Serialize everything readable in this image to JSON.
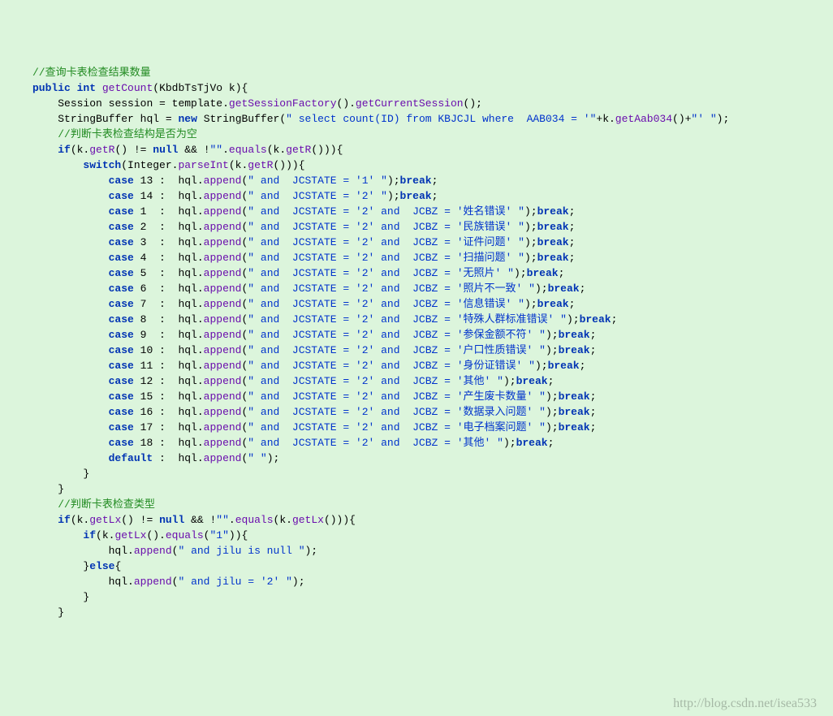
{
  "comments": {
    "c1": "//查询卡表检查结果数量",
    "c2": "//判断卡表检查结构是否为空",
    "c3": "//判断卡表检查类型"
  },
  "decl": {
    "public": "public",
    "int": "int",
    "getCount": "getCount",
    "param_type": "KbdbTsTjVo",
    "param_name": "k"
  },
  "line1": {
    "Session": "Session",
    "session": "session",
    "eq": " = ",
    "template": "template",
    "dot1": ".",
    "m1": "getSessionFactory",
    "p1": "().",
    "m2": "getCurrentSession",
    "p2": "();"
  },
  "line2": {
    "StringBuffer": "StringBuffer",
    "hql": "hql",
    "eq": " = ",
    "new": "new",
    "ctor": "StringBuffer",
    "open": "(",
    "str": "\" select count(ID) from KBJCJL where  AAB034 = '\"",
    "plus1": "+k.",
    "getAab": "getAab034",
    "plus2": "()+",
    "str2": "\"' \"",
    "close": ");"
  },
  "if1": {
    "if": "if",
    "open": "(k.",
    "getR1": "getR",
    "mid1": "() != ",
    "null": "null",
    "mid2": " && !",
    "emptystr": "\"\"",
    "dot": ".",
    "equals": "equals",
    "open2": "(k.",
    "getR2": "getR",
    "close2": "())){"
  },
  "switch": {
    "switch": "switch",
    "open": "(Integer.",
    "parseInt": "parseInt",
    "open2": "(k.",
    "getR": "getR",
    "close": "())){"
  },
  "append_label": "append",
  "break_label": "break",
  "case_label": "case",
  "default_label": "default",
  "hql_label": "hql",
  "cases": [
    {
      "num": "13",
      "pad": " ",
      "str": "\" and  JCSTATE = '1' \"",
      "hasBreak": true
    },
    {
      "num": "14",
      "pad": " ",
      "str": "\" and  JCSTATE = '2' \"",
      "hasBreak": true
    },
    {
      "num": "1",
      "pad": "  ",
      "str": "\" and  JCSTATE = '2' and  JCBZ = '姓名错误' \"",
      "hasBreak": true
    },
    {
      "num": "2",
      "pad": "  ",
      "str": "\" and  JCSTATE = '2' and  JCBZ = '民族错误' \"",
      "hasBreak": true
    },
    {
      "num": "3",
      "pad": "  ",
      "str": "\" and  JCSTATE = '2' and  JCBZ = '证件问题' \"",
      "hasBreak": true
    },
    {
      "num": "4",
      "pad": "  ",
      "str": "\" and  JCSTATE = '2' and  JCBZ = '扫描问题' \"",
      "hasBreak": true
    },
    {
      "num": "5",
      "pad": "  ",
      "str": "\" and  JCSTATE = '2' and  JCBZ = '无照片' \"",
      "hasBreak": true
    },
    {
      "num": "6",
      "pad": "  ",
      "str": "\" and  JCSTATE = '2' and  JCBZ = '照片不一致' \"",
      "hasBreak": true
    },
    {
      "num": "7",
      "pad": "  ",
      "str": "\" and  JCSTATE = '2' and  JCBZ = '信息错误' \"",
      "hasBreak": true
    },
    {
      "num": "8",
      "pad": "  ",
      "str": "\" and  JCSTATE = '2' and  JCBZ = '特殊人群标准错误' \"",
      "hasBreak": true
    },
    {
      "num": "9",
      "pad": "  ",
      "str": "\" and  JCSTATE = '2' and  JCBZ = '参保金额不符' \"",
      "hasBreak": true
    },
    {
      "num": "10",
      "pad": " ",
      "str": "\" and  JCSTATE = '2' and  JCBZ = '户口性质错误' \"",
      "hasBreak": true
    },
    {
      "num": "11",
      "pad": " ",
      "str": "\" and  JCSTATE = '2' and  JCBZ = '身份证错误' \"",
      "hasBreak": true
    },
    {
      "num": "12",
      "pad": " ",
      "str": "\" and  JCSTATE = '2' and  JCBZ = '其他' \"",
      "hasBreak": true
    },
    {
      "num": "15",
      "pad": " ",
      "str": "\" and  JCSTATE = '2' and  JCBZ = '产生废卡数量' \"",
      "hasBreak": true
    },
    {
      "num": "16",
      "pad": " ",
      "str": "\" and  JCSTATE = '2' and  JCBZ = '数据录入问题' \"",
      "hasBreak": true
    },
    {
      "num": "17",
      "pad": " ",
      "str": "\" and  JCSTATE = '2' and  JCBZ = '电子档案问题' \"",
      "hasBreak": true
    },
    {
      "num": "18",
      "pad": " ",
      "str": "\" and  JCSTATE = '2' and  JCBZ = '其他' \"",
      "hasBreak": true
    }
  ],
  "default_str": "\" \"",
  "close_brace": "}",
  "if2": {
    "if": "if",
    "open": "(k.",
    "getLx1": "getLx",
    "mid1": "() != ",
    "null": "null",
    "mid2": " && !",
    "emptystr": "\"\"",
    "dot": ".",
    "equals": "equals",
    "open2": "(k.",
    "getLx2": "getLx",
    "close2": "())){"
  },
  "if3": {
    "if": "if",
    "open": "(k.",
    "getLx": "getLx",
    "mid": "().",
    "equals": "equals",
    "open2": "(",
    "one": "\"1\"",
    "close": ")){"
  },
  "append1": {
    "pre": "hql.",
    "m": "append",
    "open": "(",
    "str": "\" and jilu is null \"",
    "close": ");"
  },
  "else": {
    "close": "}",
    "else": "else",
    "open": "{"
  },
  "append2": {
    "pre": "hql.",
    "m": "append",
    "open": "(",
    "str": "\" and jilu = '2' \"",
    "close": ");"
  },
  "watermark": "http://blog.csdn.net/isea533"
}
